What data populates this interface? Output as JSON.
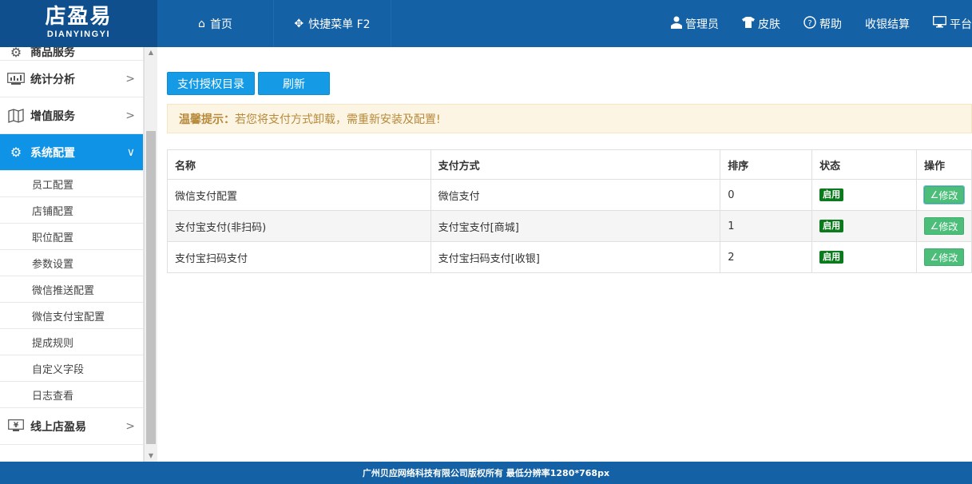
{
  "logo": {
    "main": "店盈易",
    "sub": "DIANYINGYI"
  },
  "nav": {
    "home": "首页",
    "quick_menu": "快捷菜单 F2"
  },
  "right_nav": {
    "admin": "管理员",
    "skin": "皮肤",
    "help": "帮助",
    "checkout": "收银结算",
    "platform": "平台"
  },
  "sidebar": {
    "partial_group": "商品服务",
    "groups": [
      {
        "label": "统计分析",
        "icon": "chart-icon"
      },
      {
        "label": "增值服务",
        "icon": "map-icon"
      },
      {
        "label": "系统配置",
        "icon": "gear-icon"
      }
    ],
    "sub_items": [
      "员工配置",
      "店铺配置",
      "职位配置",
      "参数设置",
      "微信推送配置",
      "微信支付宝配置",
      "提成规则",
      "自定义字段",
      "日志查看"
    ],
    "bottom_group": "线上店盈易"
  },
  "toolbar": {
    "catalog_btn": "支付授权目录",
    "refresh_btn": "刷新"
  },
  "tip": {
    "title": "温馨提示：",
    "text": "若您将支付方式卸载，需重新安装及配置!"
  },
  "table": {
    "headers": [
      "名称",
      "支付方式",
      "排序",
      "状态",
      "操作"
    ],
    "rows": [
      {
        "name": "微信支付配置",
        "method": "微信支付",
        "order": "0",
        "status": "启用",
        "action": "修改"
      },
      {
        "name": "支付宝支付(非扫码)",
        "method": "支付宝支付[商城]",
        "order": "1",
        "status": "启用",
        "action": "修改"
      },
      {
        "name": "支付宝扫码支付",
        "method": "支付宝扫码支付[收银]",
        "order": "2",
        "status": "启用",
        "action": "修改"
      }
    ]
  },
  "footer": "广州贝应网络科技有限公司版权所有 最低分辨率1280*768px"
}
